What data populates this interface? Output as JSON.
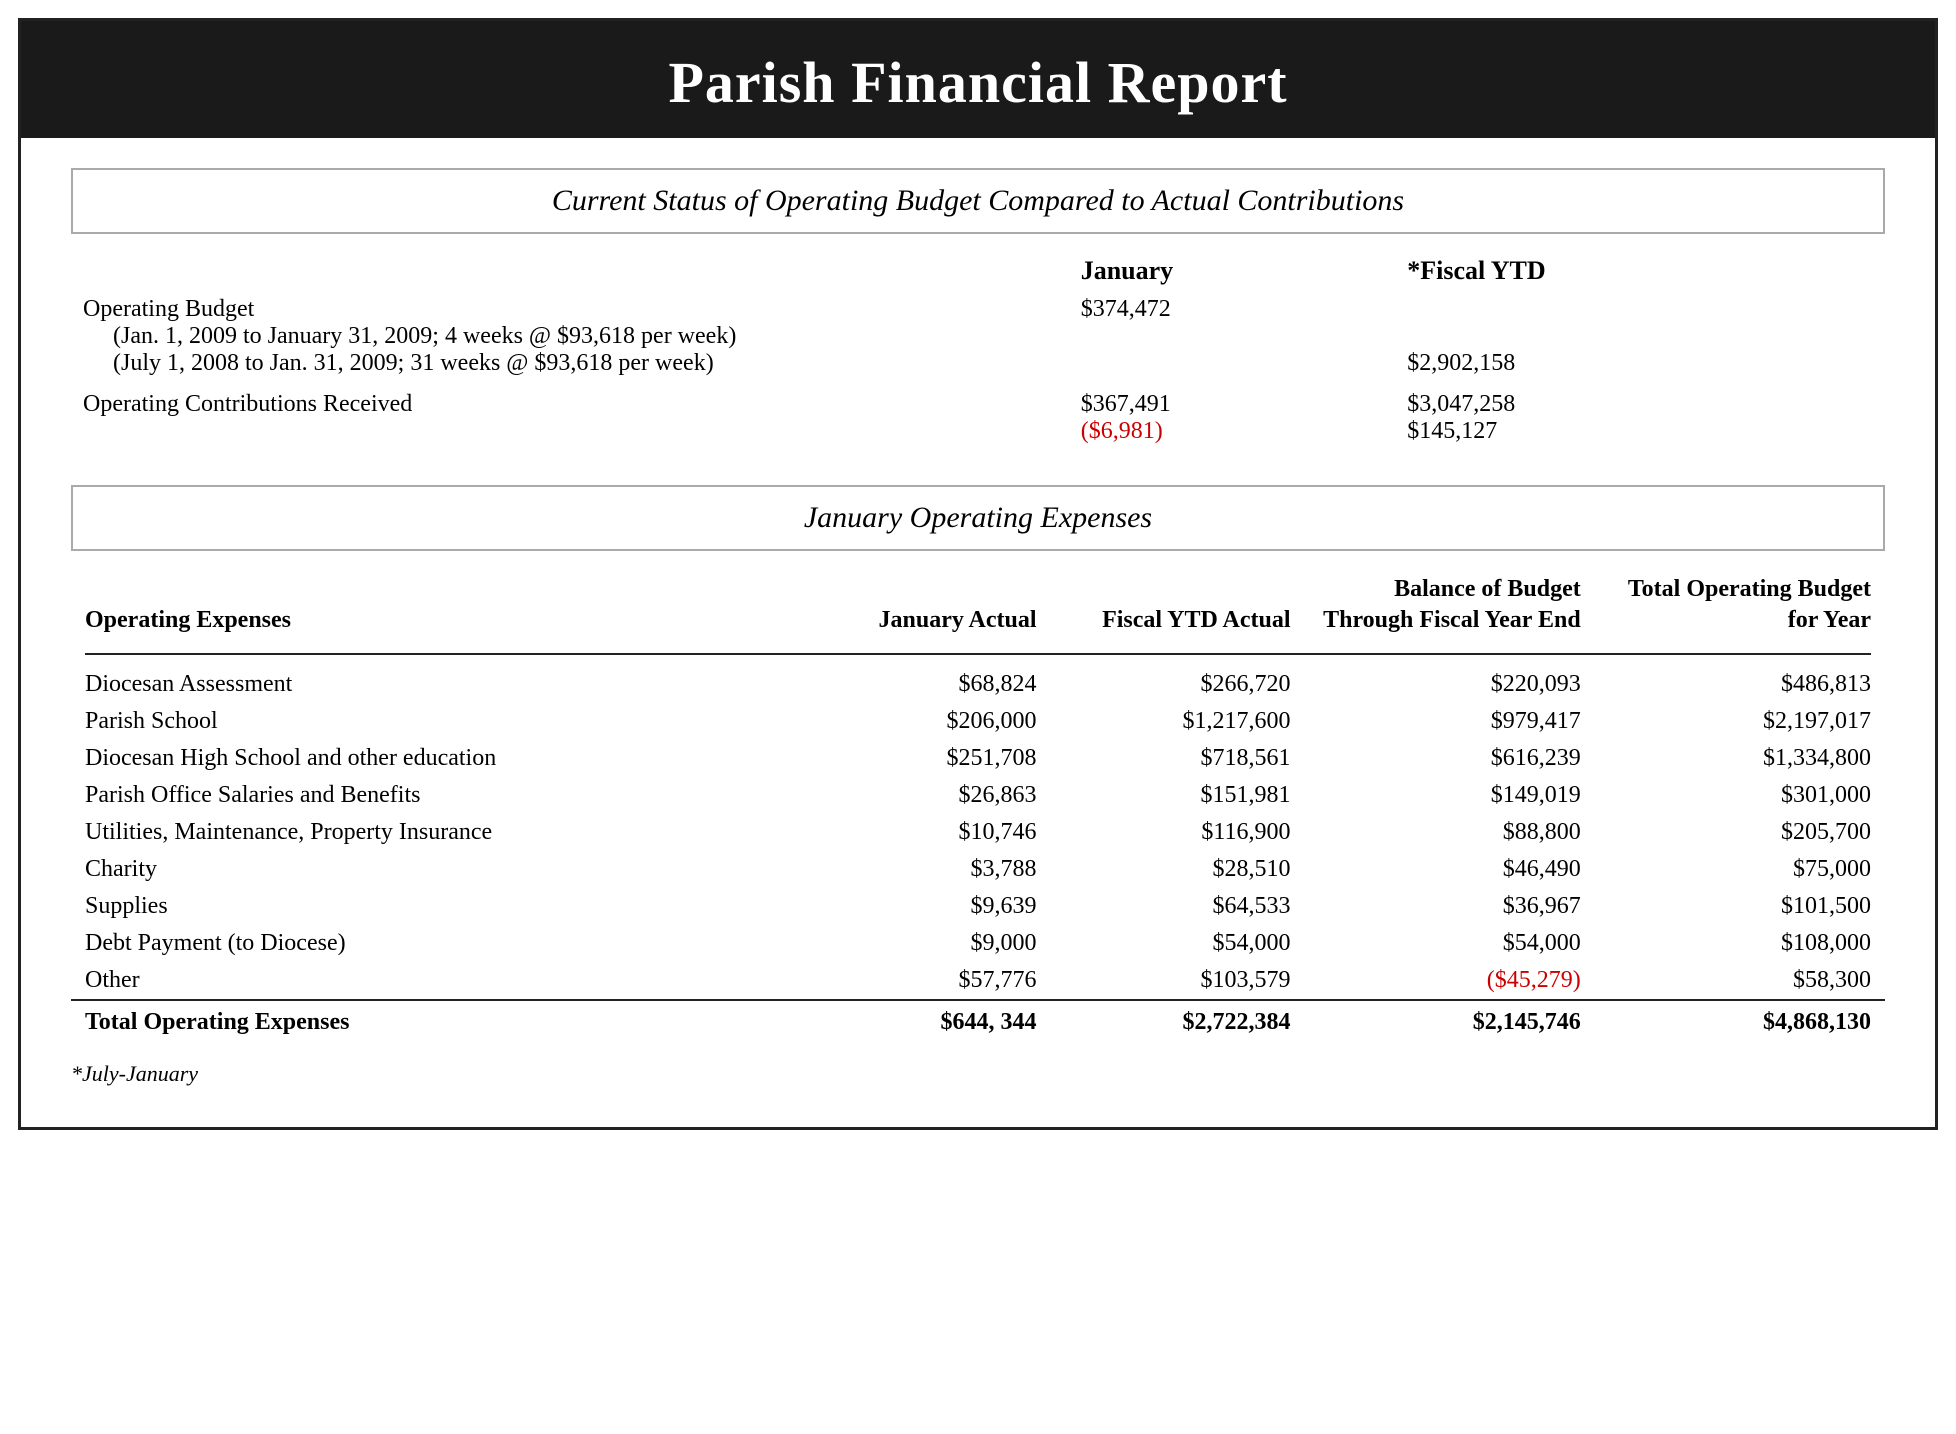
{
  "page": {
    "title": "Parish Financial Report"
  },
  "operating_budget_section": {
    "title": "Current Status of Operating Budget Compared to Actual Contributions",
    "columns": {
      "january": "January",
      "fiscal_ytd": "*Fiscal YTD"
    },
    "rows": [
      {
        "label": "Operating Budget",
        "sublabel1": "(Jan. 1, 2009 to January 31, 2009; 4 weeks @ $93,618 per week)",
        "sublabel2": "(July 1, 2008 to Jan. 31, 2009; 31 weeks @ $93,618 per week)",
        "jan_value": "$374,472",
        "ytd_value": "$2,902,158"
      },
      {
        "label": "Operating Contributions Received",
        "jan_value": "$367,491",
        "jan_diff": "($6,981)",
        "ytd_value": "$3,047,258",
        "ytd_diff": "$145,127"
      }
    ]
  },
  "expenses_section": {
    "title": "January Operating Expenses",
    "column_headers": {
      "label": "Operating Expenses",
      "jan_actual": "January Actual",
      "ytd_actual": "Fiscal YTD Actual",
      "balance": "Balance of Budget Through Fiscal Year End",
      "total_budget": "Total Operating Budget for Year"
    },
    "rows": [
      {
        "label": "Diocesan Assessment",
        "jan_actual": "$68,824",
        "ytd_actual": "$266,720",
        "balance": "$220,093",
        "total_budget": "$486,813"
      },
      {
        "label": "Parish School",
        "jan_actual": "$206,000",
        "ytd_actual": "$1,217,600",
        "balance": "$979,417",
        "total_budget": "$2,197,017"
      },
      {
        "label": "Diocesan High School and other education",
        "jan_actual": "$251,708",
        "ytd_actual": "$718,561",
        "balance": "$616,239",
        "total_budget": "$1,334,800"
      },
      {
        "label": "Parish Office Salaries and Benefits",
        "jan_actual": "$26,863",
        "ytd_actual": "$151,981",
        "balance": "$149,019",
        "total_budget": "$301,000"
      },
      {
        "label": "Utilities, Maintenance, Property Insurance",
        "jan_actual": "$10,746",
        "ytd_actual": "$116,900",
        "balance": "$88,800",
        "total_budget": "$205,700"
      },
      {
        "label": "Charity",
        "jan_actual": "$3,788",
        "ytd_actual": "$28,510",
        "balance": "$46,490",
        "total_budget": "$75,000"
      },
      {
        "label": "Supplies",
        "jan_actual": "$9,639",
        "ytd_actual": "$64,533",
        "balance": "$36,967",
        "total_budget": "$101,500"
      },
      {
        "label": "Debt Payment (to Diocese)",
        "jan_actual": "$9,000",
        "ytd_actual": "$54,000",
        "balance": "$54,000",
        "total_budget": "$108,000"
      },
      {
        "label": "Other",
        "jan_actual": "$57,776",
        "ytd_actual": "$103,579",
        "balance": "($45,279)",
        "balance_red": true,
        "total_budget": "$58,300"
      }
    ],
    "totals": {
      "label": "Total Operating Expenses",
      "jan_actual": "$644, 344",
      "ytd_actual": "$2,722,384",
      "balance": "$2,145,746",
      "total_budget": "$4,868,130"
    }
  },
  "footnote": "*July-January"
}
